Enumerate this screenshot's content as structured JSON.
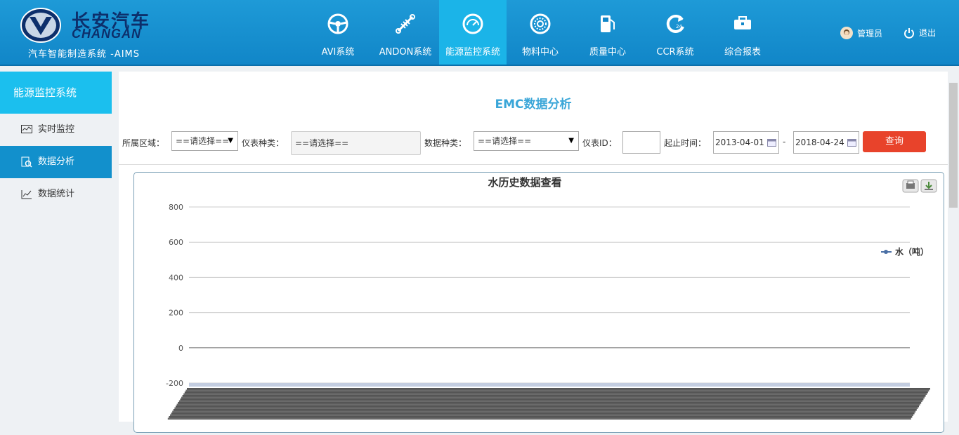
{
  "header": {
    "brand_cn": "长安汽车",
    "brand_en": "CHANGAN",
    "system_title": "汽车智能制造系统 -AIMS",
    "nav": [
      {
        "label": "AVI系统",
        "icon": "steering-wheel-icon"
      },
      {
        "label": "ANDON系统",
        "icon": "shock-absorber-icon"
      },
      {
        "label": "能源监控系统",
        "icon": "gauge-icon",
        "active": true
      },
      {
        "label": "物料中心",
        "icon": "bearing-icon"
      },
      {
        "label": "质量中心",
        "icon": "fuel-pump-icon"
      },
      {
        "label": "CCR系统",
        "icon": "refresh-24-icon"
      },
      {
        "label": "综合报表",
        "icon": "toolbox-icon"
      }
    ],
    "user_label": "管理员",
    "logout_label": "退出",
    "accent": "#1bb4e8"
  },
  "sidebar": {
    "title": "能源监控系统",
    "items": [
      {
        "label": "实时监控",
        "icon": "monitor-icon"
      },
      {
        "label": "数据分析",
        "icon": "search-analysis-icon",
        "active": true
      },
      {
        "label": "数据统计",
        "icon": "line-chart-icon"
      }
    ]
  },
  "main": {
    "page_title": "EMC数据分析",
    "filters": {
      "area_label": "所属区域：",
      "area_value": "==请选择==",
      "meter_type_label": "仪表种类：",
      "meter_type_value": "==请选择==",
      "data_type_label": "数据种类：",
      "data_type_value": "==请选择==",
      "meter_id_label": "仪表ID：",
      "meter_id_value": "",
      "time_label": "起止时间：",
      "start_date": "2013-04-01",
      "date_sep": "-",
      "end_date": "2018-04-24",
      "query_label": "查询"
    }
  },
  "chart_data": {
    "type": "line",
    "title": "水历史数据查看",
    "legend": [
      "水（吨）"
    ],
    "legend_position": "right",
    "yticks": [
      800,
      600,
      400,
      200,
      0,
      -200
    ],
    "ylim": [
      -200,
      800
    ],
    "grid": true,
    "series": [
      {
        "name": "水（吨）",
        "values": []
      }
    ]
  }
}
